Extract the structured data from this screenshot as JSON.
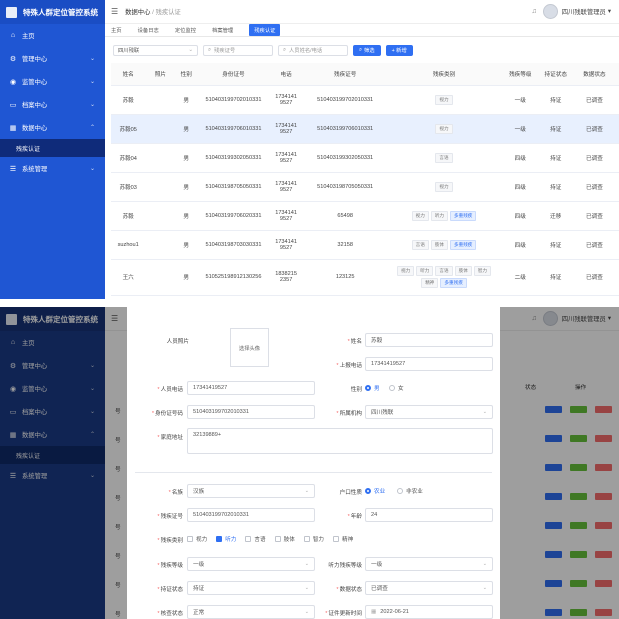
{
  "app": {
    "title": "特殊人群定位管控系统"
  },
  "sidebar": {
    "items": [
      {
        "label": "主页",
        "icon": "home-icon"
      },
      {
        "label": "管理中心",
        "icon": "settings-icon"
      },
      {
        "label": "监管中心",
        "icon": "location-pin-icon"
      },
      {
        "label": "档案中心",
        "icon": "folder-icon"
      },
      {
        "label": "数据中心",
        "icon": "grid-icon"
      },
      {
        "label": "残疾认证",
        "icon": ""
      },
      {
        "label": "系统管理",
        "icon": "menu-list-icon"
      }
    ]
  },
  "header": {
    "crumb_root": "数据中心",
    "crumb_sep": "/",
    "crumb_current": "残疾认证",
    "user": "四川残联管理员"
  },
  "tabs": [
    "主页",
    "设备日志",
    "定位监控",
    "档案管理",
    "残疾认证"
  ],
  "filters": {
    "org": "四川残联",
    "idcard_placeholder": "残疾证号",
    "name_placeholder": "人员姓名/电话",
    "search": "筛选",
    "add": "+ 新增"
  },
  "table": {
    "headers": [
      "姓名",
      "照片",
      "性别",
      "身份证号",
      "电话",
      "残疾证号",
      "残疾类别",
      "残疾等级",
      "持证状态",
      "数据状态"
    ],
    "rows": [
      {
        "name": "苏毅",
        "gender": "男",
        "idcard": "510403199702010331",
        "phone1": "1734141",
        "phone2": "9527",
        "cert": "510403199702010331",
        "cats": [
          "视力"
        ],
        "level": "一级",
        "hold": "持证",
        "status": "已调查"
      },
      {
        "name": "苏毅05",
        "gender": "男",
        "idcard": "510403199706010331",
        "phone1": "1734141",
        "phone2": "9527",
        "cert": "510403199706010331",
        "cats": [
          "视力"
        ],
        "level": "一级",
        "hold": "持证",
        "status": "已调查"
      },
      {
        "name": "苏毅04",
        "gender": "男",
        "idcard": "510403199302050331",
        "phone1": "1734141",
        "phone2": "9527",
        "cert": "510403199302050331",
        "cats": [
          "言语"
        ],
        "level": "四级",
        "hold": "持证",
        "status": "已调查"
      },
      {
        "name": "苏毅03",
        "gender": "男",
        "idcard": "510403198705050331",
        "phone1": "1734141",
        "phone2": "9527",
        "cert": "510403198705050331",
        "cats": [
          "视力"
        ],
        "level": "四级",
        "hold": "持证",
        "status": "已调查"
      },
      {
        "name": "苏毅",
        "gender": "男",
        "idcard": "510403199706020331",
        "phone1": "1734141",
        "phone2": "9527",
        "cert": "65498",
        "cats": [
          "视力",
          "听力",
          "多重残疾"
        ],
        "level": "四级",
        "hold": "迁移",
        "status": "已调查"
      },
      {
        "name": "suzhou1",
        "gender": "男",
        "idcard": "510403198703030331",
        "phone1": "1734141",
        "phone2": "9527",
        "cert": "32158",
        "cats": [
          "言语",
          "肢体",
          "多重残疾"
        ],
        "level": "四级",
        "hold": "持证",
        "status": "已调查"
      },
      {
        "name": "王六",
        "gender": "男",
        "idcard": "510525198912130256",
        "phone1": "1838215",
        "phone2": "2357",
        "cert": "123125",
        "cats": [
          "视力",
          "听力",
          "言语",
          "肢体",
          "智力",
          "精神",
          "多重残疾"
        ],
        "level": "二级",
        "hold": "持证",
        "status": "已调查"
      }
    ]
  },
  "bottom_bg": {
    "status_header": "状态",
    "ops_header": "操作",
    "row_letter": "号"
  },
  "dialog": {
    "photo_label": "人员照片",
    "photo_btn": "选择头像",
    "name_label": "姓名",
    "name_value": "苏毅",
    "report_phone_label": "上报电话",
    "report_phone_value": "17341419527",
    "phone_label": "人员电话",
    "phone_value": "17341419527",
    "gender_label": "性别",
    "gender_male": "男",
    "gender_female": "女",
    "idcard_label": "身份证号码",
    "idcard_value": "510403199702010331",
    "org_label": "所属机构",
    "org_value": "四川残联",
    "addr_label": "家庭地址",
    "addr_value": "32139889+",
    "nation_label": "名族",
    "nation_value": "汉族",
    "hukou_label": "户口性质",
    "hukou_farm": "农业",
    "hukou_nonfarm": "非农业",
    "cert_label": "残疾证号",
    "cert_value": "510403199702010331",
    "age_label": "年龄",
    "age_value": "24",
    "cat_label": "残疾类别",
    "cats": [
      "视力",
      "听力",
      "言语",
      "肢体",
      "智力",
      "精神"
    ],
    "level_label": "残疾等级",
    "level_value": "一级",
    "hear_level_label": "听力残疾等级",
    "hear_level_value": "一级",
    "hold_label": "持证状态",
    "hold_value": "持证",
    "data_label": "数据状态",
    "data_value": "已调查",
    "check_label": "核查状态",
    "check_value": "正常",
    "update_label": "证件更新时间",
    "update_value": "2022-06-21"
  },
  "colors": {
    "sidebar": "#1f56d3",
    "accent": "#2f6ff2",
    "edit": "#2f6ff2",
    "review": "#67c23a",
    "delete": "#f56c6c"
  }
}
